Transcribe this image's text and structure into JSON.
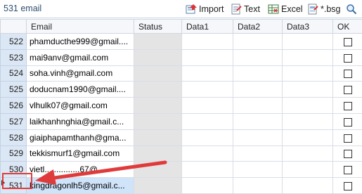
{
  "header": {
    "count_label": "531 email",
    "buttons": {
      "import": "Import",
      "text": "Text",
      "excel": "Excel",
      "bsg": "*.bsg"
    }
  },
  "columns": [
    "",
    "Email",
    "Status",
    "Data1",
    "Data2",
    "Data3",
    "OK"
  ],
  "rows": [
    {
      "num": "522",
      "email": "phamducthe999@gmail...."
    },
    {
      "num": "523",
      "email": "mai9anv@gmail.com"
    },
    {
      "num": "524",
      "email": "soha.vinh@gmail.com"
    },
    {
      "num": "525",
      "email": "doducnam1990@gmail...."
    },
    {
      "num": "526",
      "email": "vlhulk07@gmail.com"
    },
    {
      "num": "527",
      "email": "laikhanhnghia@gmail.c..."
    },
    {
      "num": "528",
      "email": "giaiphapamthanh@gma..."
    },
    {
      "num": "529",
      "email": "tekkismurf1@gmail.com"
    },
    {
      "num": "530",
      "email": "vietl...............67@..."
    },
    {
      "num": "531",
      "email": "kingdragonlh5@gmail.c..."
    }
  ],
  "colors": {
    "accent_red": "#e03b3b",
    "rownum_bg": "#dce7f5",
    "status_bg": "#e4e4e4",
    "selected_bg": "#cfe3f9"
  },
  "icons": {
    "import": "import-icon",
    "text": "text-file-icon",
    "excel": "excel-icon",
    "bsg": "bsg-file-icon",
    "search": "search-icon"
  }
}
